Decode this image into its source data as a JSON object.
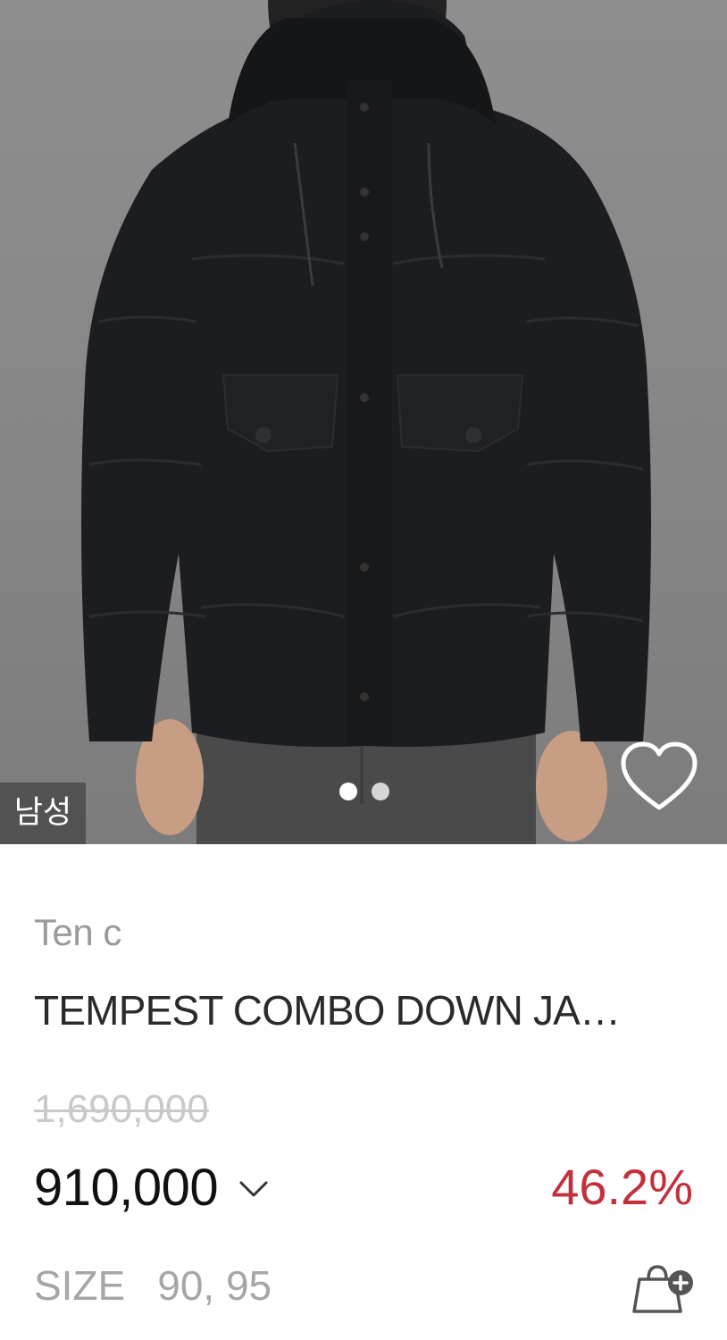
{
  "image": {
    "gender_badge": "남성",
    "slide_count": 2,
    "active_slide": 1
  },
  "product": {
    "brand": "Ten c",
    "name": "TEMPEST COMBO DOWN JA…",
    "original_price": "1,690,000",
    "sale_price": "910,000",
    "discount_rate": "46.2%",
    "size_label": "SIZE",
    "sizes": "90, 95"
  },
  "icons": {
    "wish": "heart-outline-icon",
    "expand": "chevron-down-icon",
    "cart": "shopping-bag-plus-icon"
  },
  "colors": {
    "discount": "#c2303c",
    "brand_text": "#9a9a9a",
    "strike_price": "#c9c9c9"
  }
}
